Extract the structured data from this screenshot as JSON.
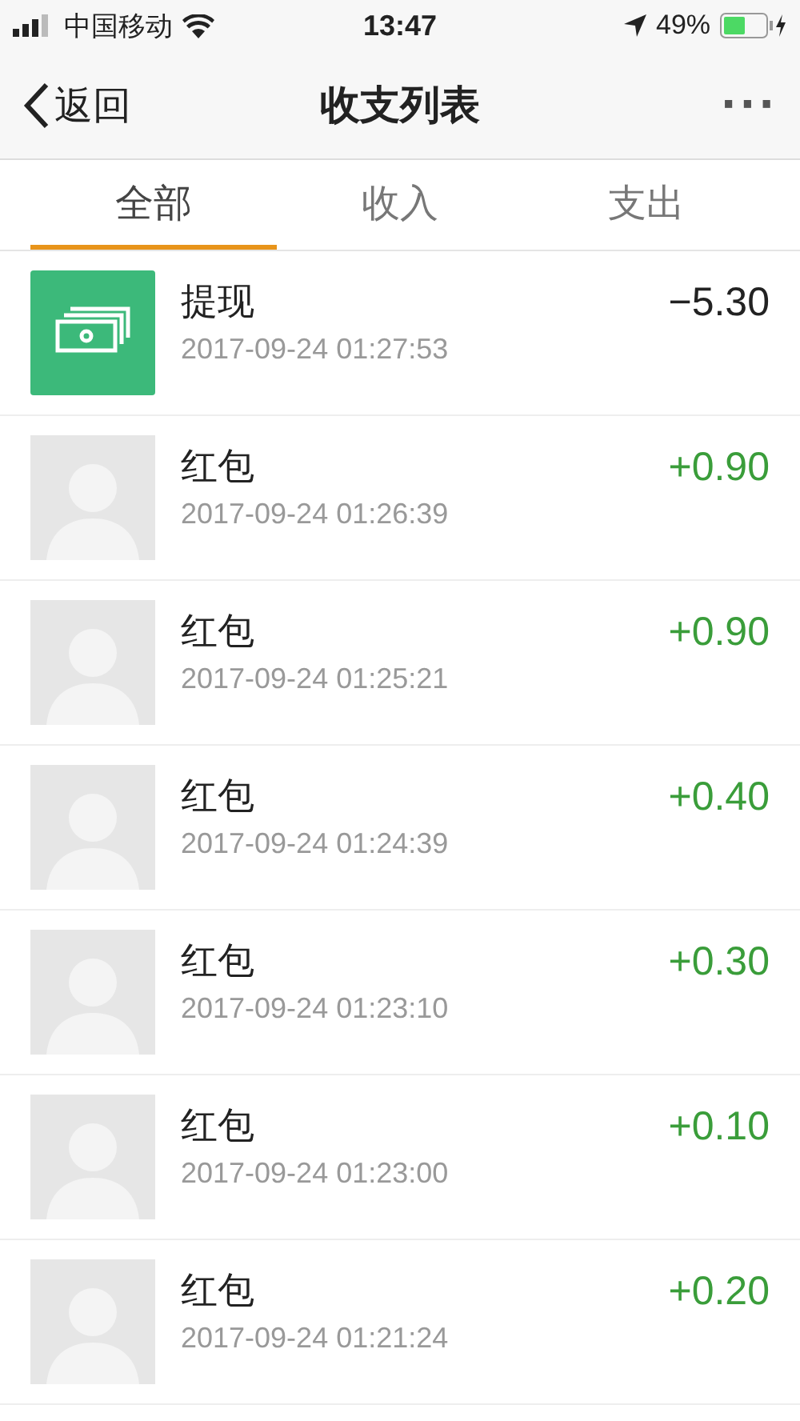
{
  "status_bar": {
    "carrier": "中国移动",
    "time": "13:47",
    "battery": "49%"
  },
  "nav": {
    "back": "返回",
    "title": "收支列表",
    "more": "···"
  },
  "tabs": [
    {
      "label": "全部",
      "selected": true
    },
    {
      "label": "收入",
      "selected": false
    },
    {
      "label": "支出",
      "selected": false
    }
  ],
  "transactions": [
    {
      "kind": "withdrawal",
      "title": "提现",
      "time": "2017-09-24 01:27:53",
      "amount": "−5.30"
    },
    {
      "kind": "red_packet",
      "title": "红包",
      "time": "2017-09-24 01:26:39",
      "amount": "+0.90"
    },
    {
      "kind": "red_packet",
      "title": "红包",
      "time": "2017-09-24 01:25:21",
      "amount": "+0.90"
    },
    {
      "kind": "red_packet",
      "title": "红包",
      "time": "2017-09-24 01:24:39",
      "amount": "+0.40"
    },
    {
      "kind": "red_packet",
      "title": "红包",
      "time": "2017-09-24 01:23:10",
      "amount": "+0.30"
    },
    {
      "kind": "red_packet",
      "title": "红包",
      "time": "2017-09-24 01:23:00",
      "amount": "+0.10"
    },
    {
      "kind": "red_packet",
      "title": "红包",
      "time": "2017-09-24 01:21:24",
      "amount": "+0.20"
    }
  ]
}
